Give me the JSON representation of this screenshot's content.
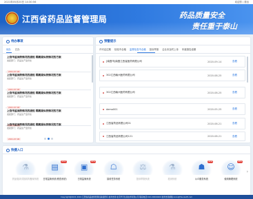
{
  "topbar": {
    "datetime": "2021年05月20日 14:30:56",
    "links": "欢迎您 | 退出"
  },
  "header": {
    "title": "江西省药品监督管理局",
    "slogan_line1": "药品质量安全",
    "slogan_line2": "责任重于泰山"
  },
  "todo": {
    "title": "待办事项",
    "tabs": [
      "待办",
      "已办"
    ],
    "active_tab": 0,
    "items": [
      {
        "title": "上饶市监测药情况的通知 隔离疑似药情况的方案",
        "meta": "发起部门：药品生产监管处",
        "date": "2021-07-06"
      },
      {
        "title": "上饶市监测药情况的通知 隔离疑似药情况的方案",
        "meta": "发起部门：药品生产监管处",
        "date": "2021-07-06"
      },
      {
        "title": "上饶市监测药情况的通知 隔离疑似药情况的方案",
        "meta": "发起部门：药品生产监管处",
        "date": "2021-07-06"
      },
      {
        "title": "上饶市监测药情况的通知 隔离疑似药情况的方案",
        "meta": "发起部门：药品生产监管处",
        "date": "2021-07-06"
      },
      {
        "title": "上饶市监测药情况的通知 隔离疑似药情况的方案",
        "meta": "发起部门：药品生产监管处",
        "date": "2021-07-06"
      }
    ],
    "pages": 3,
    "active_page": 1
  },
  "alerts": {
    "title": "预警提示",
    "tabs": [
      "许可证过期",
      "检验不合格",
      "监督检查不合格",
      "投诉举报",
      "企业未及时上传",
      "年度报告逾期"
    ],
    "active_tab": 2,
    "view_label": "查看",
    "rows": [
      {
        "name": "[南昌市]南昌江西省医药有限公司",
        "date": "2020-09-14"
      },
      {
        "name": "302江西赣州医药有限公司",
        "date": "2020-08-25"
      },
      {
        "name": "302江西赣州医药有限公司",
        "date": "2020-08-25"
      },
      {
        "name": "demo001",
        "date": "2020-05-25"
      },
      {
        "name": "江西省药品有限公司01",
        "date": "2020-08-21"
      },
      {
        "name": "江西省药品有限公司121",
        "date": "2020-08-21"
      }
    ]
  },
  "quick": {
    "title": "快捷入口",
    "next_label": "›",
    "items": [
      {
        "label": "药品临床试验机构备案系统",
        "icon": "microscope-icon",
        "glyph": "⚗",
        "badge": "",
        "faded": true
      },
      {
        "label": "日常监管系统(稽查系统)",
        "icon": "document-icon",
        "glyph": "▤",
        "badge": "NEW",
        "faded": false
      },
      {
        "label": "日常监管系统",
        "icon": "monitor-icon",
        "glyph": "▣",
        "badge": "NEW",
        "faded": false
      },
      {
        "label": "接收任务系统",
        "icon": "inbox-icon",
        "glyph": "☖",
        "badge": "",
        "faded": false
      },
      {
        "label": "投诉举报系统",
        "icon": "gavel-icon",
        "glyph": "⚖",
        "badge": "",
        "faded": true
      },
      {
        "label": "检测系统",
        "icon": "flask-icon",
        "glyph": "⚗",
        "badge": "",
        "faded": true
      },
      {
        "label": "公众服务系统",
        "icon": "handshake-icon",
        "glyph": "☗",
        "badge": "NEW",
        "faded": false
      },
      {
        "label": "使用管理系统",
        "icon": "person-icon",
        "glyph": "☺",
        "badge": "NEW",
        "faded": false
      }
    ]
  },
  "footer": {
    "text": "Copyright@2021 2019 江西省药品监督管理局版权所有 技术支持:北京华宇信息技术有限公司 联系电话:010-00000000 技术支持邮箱:xxxx@thunisoft.com"
  }
}
